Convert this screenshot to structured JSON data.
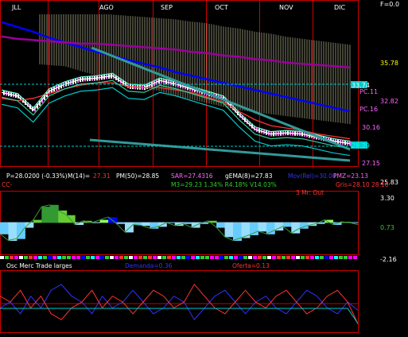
{
  "header": {
    "months": [
      "JLL",
      "AGO",
      "SEP",
      "OCT",
      "NOV",
      "DIC"
    ],
    "top_right": "F=0.0"
  },
  "price_panel": {
    "axis_labels": [
      "35.78",
      "33.74",
      "32.82",
      "30.16",
      "28.29",
      "27.15",
      "25.83"
    ],
    "axis_label_colors": [
      "#ffff00",
      "#ffffff",
      "#ff66ff",
      "#ff66ff",
      "#00ffff",
      "#ff66ff",
      "#ffffff"
    ],
    "side_labels": [
      "PC.11",
      "PC.16"
    ]
  },
  "indicator_row1": {
    "price": "P=28.0200 (-0.33%)",
    "im14_label": "M(14)=",
    "im14_value": "27.31",
    "pm50": "PM(50)=28.85",
    "sar": "SAR=27.4316",
    "gema": "gEMA(8)=27.83",
    "mov": "Mov(Rel)=30.00",
    "pmz": "PMZ=23.13"
  },
  "indicator_row2": {
    "cc": "CC-",
    "m3": "M3=29.23 1.34% R4.18% V14.03%",
    "gris": "Gris=28.10 28.10"
  },
  "osc_panel": {
    "title": "3 Mr: Out",
    "axis_labels": [
      "3.30",
      "0.73",
      "-2.16"
    ]
  },
  "bottom_panel": {
    "title": "Osc Merc Trade larges",
    "demanda": "Demanda=0.36",
    "oferta": "Oferta=0.13"
  },
  "colors": {
    "background": "#000000",
    "grid_red": "#cc0000",
    "cloud": "#ffffcc",
    "blue_line": "#0000ff",
    "purple_line": "#990099",
    "teal_line": "#339999"
  },
  "chart_data": [
    {
      "type": "line",
      "title": "",
      "x_categories": [
        "JLL",
        "AGO",
        "SEP",
        "OCT",
        "NOV",
        "DIC"
      ],
      "y_ticks": [
        35.78,
        33.74,
        32.82,
        30.16,
        28.29,
        27.15,
        25.83
      ],
      "ylim": [
        25.5,
        39.0
      ],
      "series": [
        {
          "values": [
            31.5,
            31.2,
            30.0,
            31.6,
            32.2,
            32.6,
            32.7,
            32.9,
            32.0,
            31.9,
            32.5,
            32.2,
            31.8,
            31.4,
            31.0,
            29.6,
            28.4,
            28.0,
            28.1,
            28.0,
            27.7,
            27.4,
            27.2
          ]
        },
        {
          "values": [
            31.0,
            30.8,
            31.0,
            31.4,
            31.8,
            32.1,
            32.3,
            32.3,
            32.0,
            31.9,
            31.9,
            31.7,
            31.5,
            31.1,
            30.7,
            29.9,
            29.2,
            28.7,
            28.5,
            28.3,
            28.0,
            27.8,
            27.6
          ]
        },
        {
          "values": [
            37.4,
            37.0,
            36.6,
            36.1,
            35.7,
            35.3,
            34.9,
            34.6,
            34.2,
            33.9,
            33.6,
            33.2,
            32.9,
            32.6,
            32.3,
            32.0,
            31.7,
            31.4,
            31.1,
            30.8,
            30.5,
            30.2,
            29.9
          ]
        },
        {
          "values": [
            36.2,
            36.0,
            35.9,
            35.8,
            35.7,
            35.6,
            35.6,
            35.5,
            35.4,
            35.3,
            35.2,
            35.1,
            34.9,
            34.8,
            34.6,
            34.5,
            34.3,
            34.2,
            34.0,
            33.9,
            33.8,
            33.7,
            33.6
          ]
        }
      ]
    },
    {
      "type": "area",
      "title": "3 Mr: Out",
      "y_ticks": [
        3.3,
        0.73,
        -2.16
      ],
      "ylim": [
        -2.6,
        3.6
      ],
      "values": [
        -0.5,
        -1.2,
        -1.0,
        0.2,
        1.0,
        2.4,
        2.6,
        2.0,
        1.5,
        0.5,
        0.9,
        0.7,
        1.0,
        1.3,
        0.6,
        -0.3,
        0.5,
        0.4,
        0.1,
        0.3,
        0.7,
        0.4,
        0.6,
        0.2,
        0.6,
        0.9,
        0.2,
        -0.8,
        -1.2,
        -0.9,
        -0.6,
        -0.2,
        -0.5,
        -0.1,
        0.3,
        -0.4,
        0.1,
        0.4,
        0.6,
        1.0,
        0.5,
        0.8,
        0.7,
        0.5
      ]
    },
    {
      "type": "line",
      "title": "Osc Merc Trade larges",
      "series": [
        {
          "name": "Demanda",
          "values": [
            0.4,
            0.5,
            0.3,
            0.6,
            0.4,
            0.7,
            0.8,
            0.6,
            0.5,
            0.3,
            0.6,
            0.4,
            0.5,
            0.7,
            0.5,
            0.3,
            0.4,
            0.6,
            0.5,
            0.2,
            0.4,
            0.6,
            0.7,
            0.5,
            0.3,
            0.5,
            0.6,
            0.4,
            0.3,
            0.5,
            0.7,
            0.6,
            0.4,
            0.3,
            0.5,
            0.36
          ]
        },
        {
          "name": "Oferta",
          "values": [
            0.6,
            0.5,
            0.7,
            0.4,
            0.6,
            0.3,
            0.2,
            0.4,
            0.5,
            0.7,
            0.4,
            0.6,
            0.5,
            0.3,
            0.5,
            0.7,
            0.6,
            0.4,
            0.5,
            0.8,
            0.6,
            0.4,
            0.3,
            0.5,
            0.7,
            0.5,
            0.4,
            0.6,
            0.7,
            0.5,
            0.3,
            0.4,
            0.6,
            0.7,
            0.5,
            0.13
          ]
        }
      ]
    }
  ]
}
